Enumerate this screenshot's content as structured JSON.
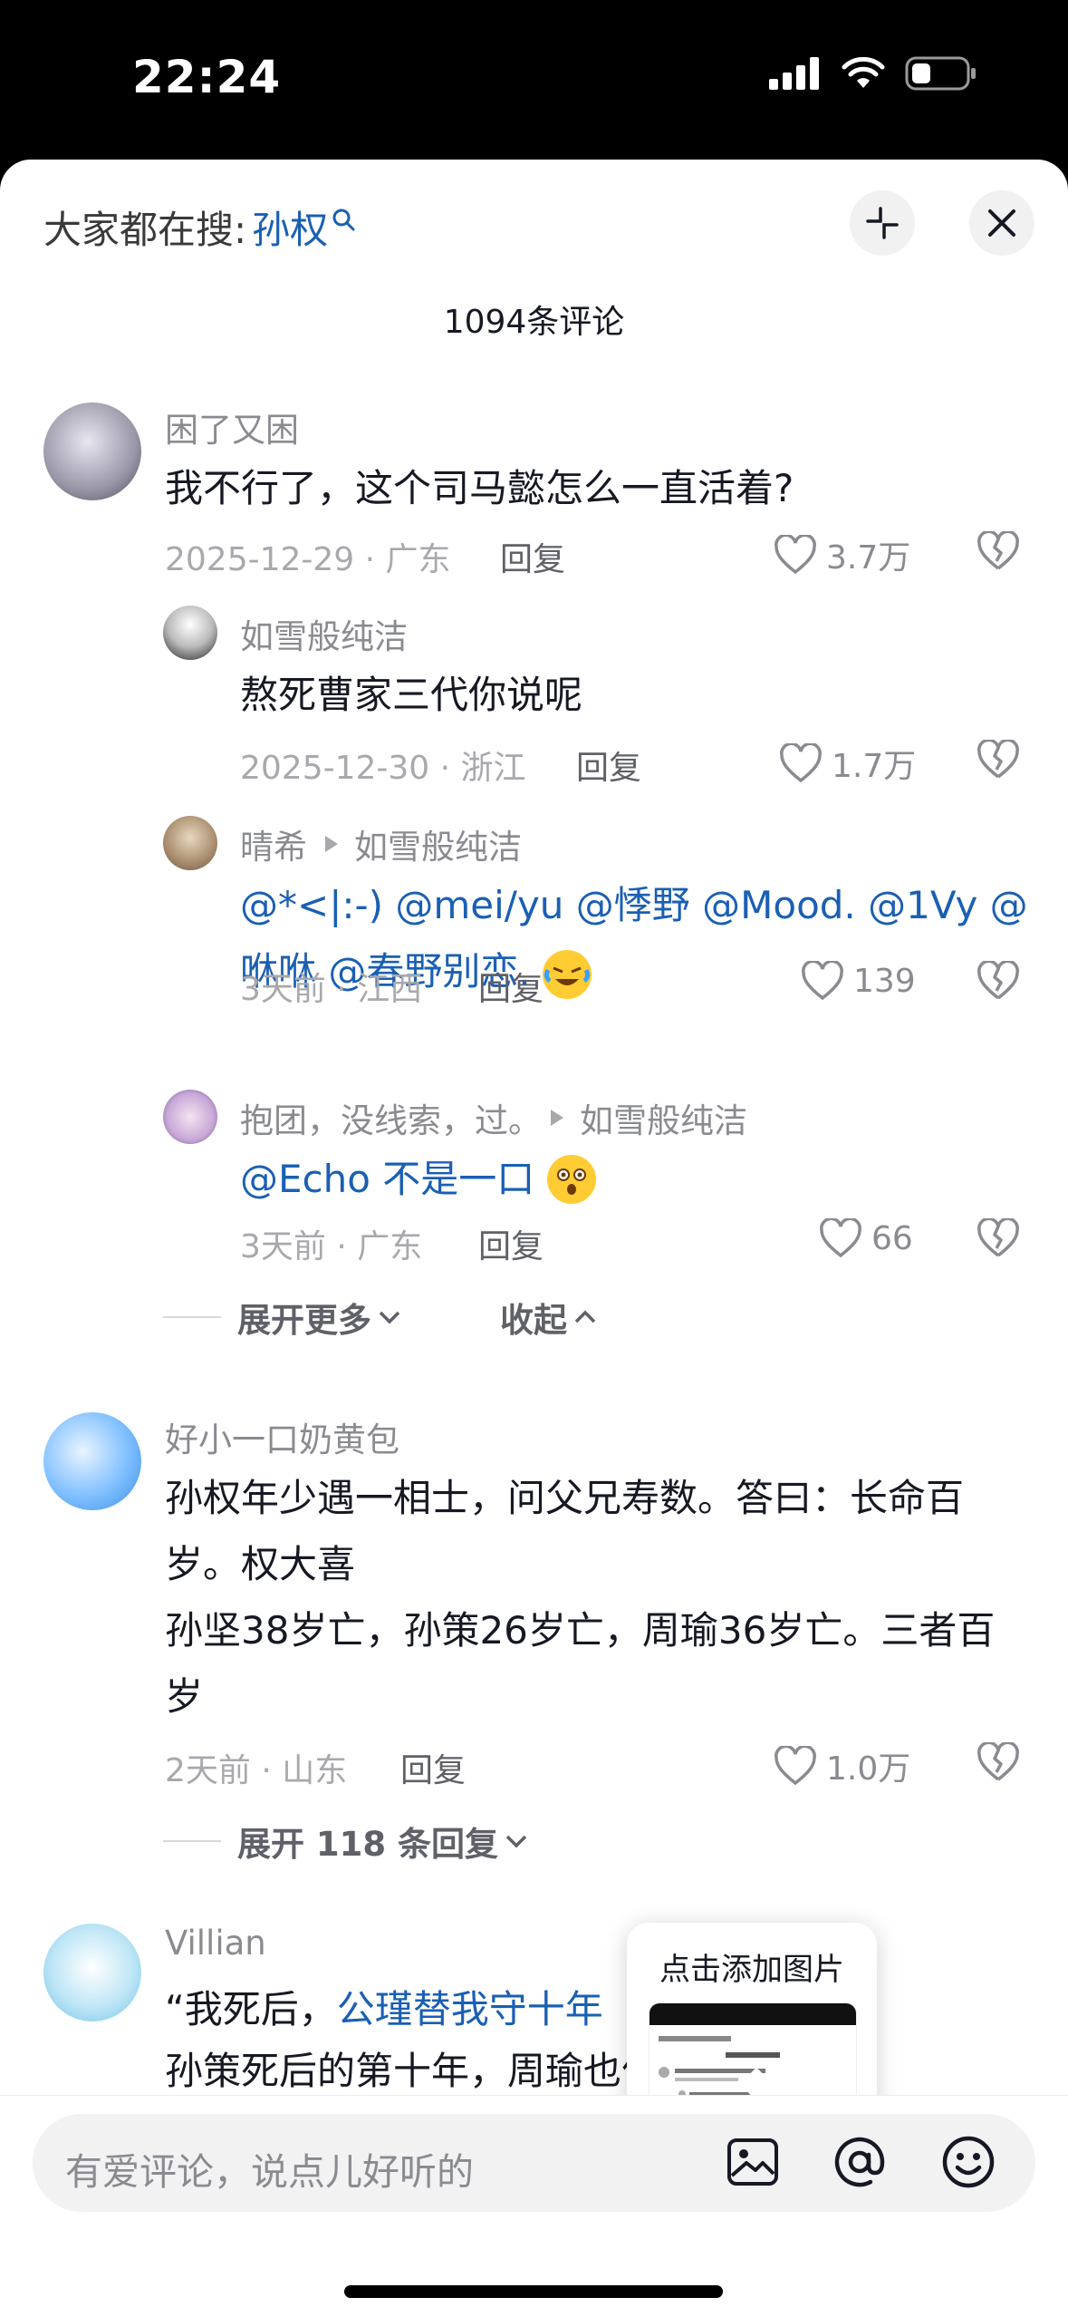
{
  "status_bar": {
    "time": "22:24"
  },
  "header": {
    "hot_search_prefix": "大家都在搜:",
    "hot_search_keyword": "孙权",
    "comment_count": "1094条评论"
  },
  "comments": [
    {
      "user": "困了又困",
      "text": "我不行了，这个司马懿怎么一直活着?",
      "meta": "2025-12-29 · 广东",
      "reply": "回复",
      "likes": "3.7万",
      "replies": [
        {
          "user": "如雪般纯洁",
          "text": "熬死曹家三代你说呢",
          "meta": "2025-12-30 · 浙江",
          "reply": "回复",
          "likes": "1.7万"
        },
        {
          "user": "晴希",
          "reply_to": "如雪般纯洁",
          "text": "@*<|:-) @mei/yu @悸野  @Mood. @1Vy @咻咻  @春野别恋.",
          "meta": "3天前 · 江西",
          "reply": "回复",
          "likes": "139"
        },
        {
          "user": "抱团，没线索，过。",
          "reply_to": "如雪般纯洁",
          "text": "@Echo 不是一口",
          "meta": "3天前 · 广东",
          "reply": "回复",
          "likes": "66"
        }
      ],
      "expand_more": "展开更多",
      "collapse": "收起"
    },
    {
      "user": "好小一口奶黄包",
      "text_line1": "孙权年少遇一相士，问父兄寿数。答曰：长命百岁。权大喜",
      "text_line2": "孙坚38岁亡，孙策26岁亡，周瑜36岁亡。三者百岁",
      "meta": "2天前 · 山东",
      "reply": "回复",
      "likes": "1.0万",
      "expand_replies": "展开 118 条回复"
    },
    {
      "user": "Villian",
      "text_prefix": "“我死后，",
      "text_mention": "公瑾替我守十年",
      "text_line2": "孙策死后的第十年，周瑜也便离开了"
    }
  ],
  "popup": {
    "title": "点击添加图片"
  },
  "input": {
    "placeholder": "有爱评论，说点儿好听的"
  },
  "colors": {
    "mention": "#1a5fb4",
    "meta": "#a8a9ad",
    "background": "#ffffff"
  }
}
